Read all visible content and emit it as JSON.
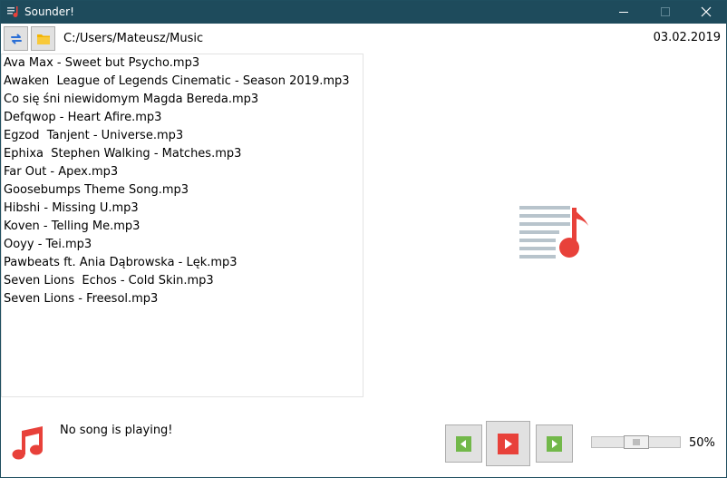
{
  "window": {
    "title": "Sounder!"
  },
  "toolbar": {
    "refresh_icon": "refresh-icon",
    "folder_icon": "folder-icon",
    "path": "C:/Users/Mateusz/Music",
    "date": "03.02.2019"
  },
  "songs": [
    "Ava Max - Sweet but Psycho.mp3",
    "Awaken  League of Legends Cinematic - Season 2019.mp3",
    "Co się śni niewidomym Magda Bereda.mp3",
    "Defqwop - Heart Afire.mp3",
    "Egzod  Tanjent - Universe.mp3",
    "Ephixa  Stephen Walking - Matches.mp3",
    "Far Out - Apex.mp3",
    "Goosebumps Theme Song.mp3",
    "Hibshi - Missing U.mp3",
    "Koven - Telling Me.mp3",
    "Ooyy - Tei.mp3",
    "Pawbeats ft. Ania Dąbrowska - Lęk.mp3",
    "Seven Lions  Echos - Cold Skin.mp3",
    "Seven Lions - Freesol.mp3"
  ],
  "now_playing": {
    "text": "No song is playing!"
  },
  "volume": {
    "label": "50%",
    "level": 0.5
  },
  "colors": {
    "titlebar": "#1e4b5c",
    "accent_red": "#e8413a",
    "refresh_blue": "#2b6fd6",
    "folder_yellow": "#f4b400",
    "nav_green": "#72b84a",
    "playlist_lines": "#b8c4cc"
  }
}
